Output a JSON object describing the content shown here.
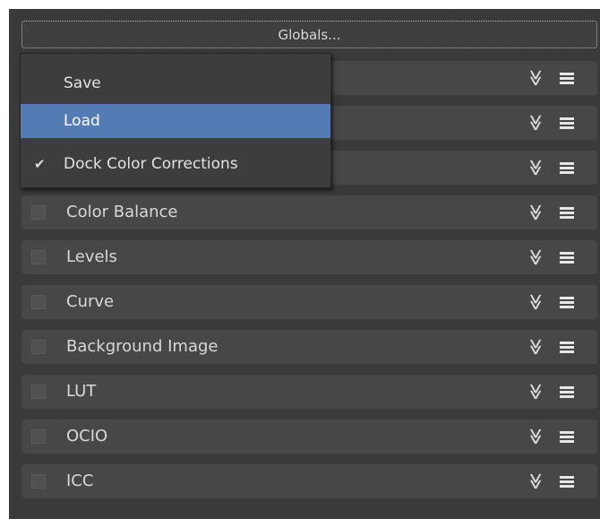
{
  "globals_button": {
    "label": "Globals..."
  },
  "dropdown": {
    "items": [
      {
        "label": "Save",
        "checked": false,
        "selected": false
      },
      {
        "label": "Load",
        "checked": false,
        "selected": true
      },
      {
        "label": "Dock Color Corrections",
        "checked": true,
        "selected": false
      }
    ],
    "check_glyph": "✔"
  },
  "rows": [
    {
      "label": ""
    },
    {
      "label": ""
    },
    {
      "label": ""
    },
    {
      "label": "Color Balance"
    },
    {
      "label": "Levels"
    },
    {
      "label": "Curve"
    },
    {
      "label": "Background Image"
    },
    {
      "label": "LUT"
    },
    {
      "label": "OCIO"
    },
    {
      "label": "ICC"
    }
  ],
  "expand_glyph": "≫",
  "colors": {
    "background": "#3a3a3a",
    "row": "#474747",
    "selection": "#557bb4",
    "text": "#d8d8d8"
  }
}
